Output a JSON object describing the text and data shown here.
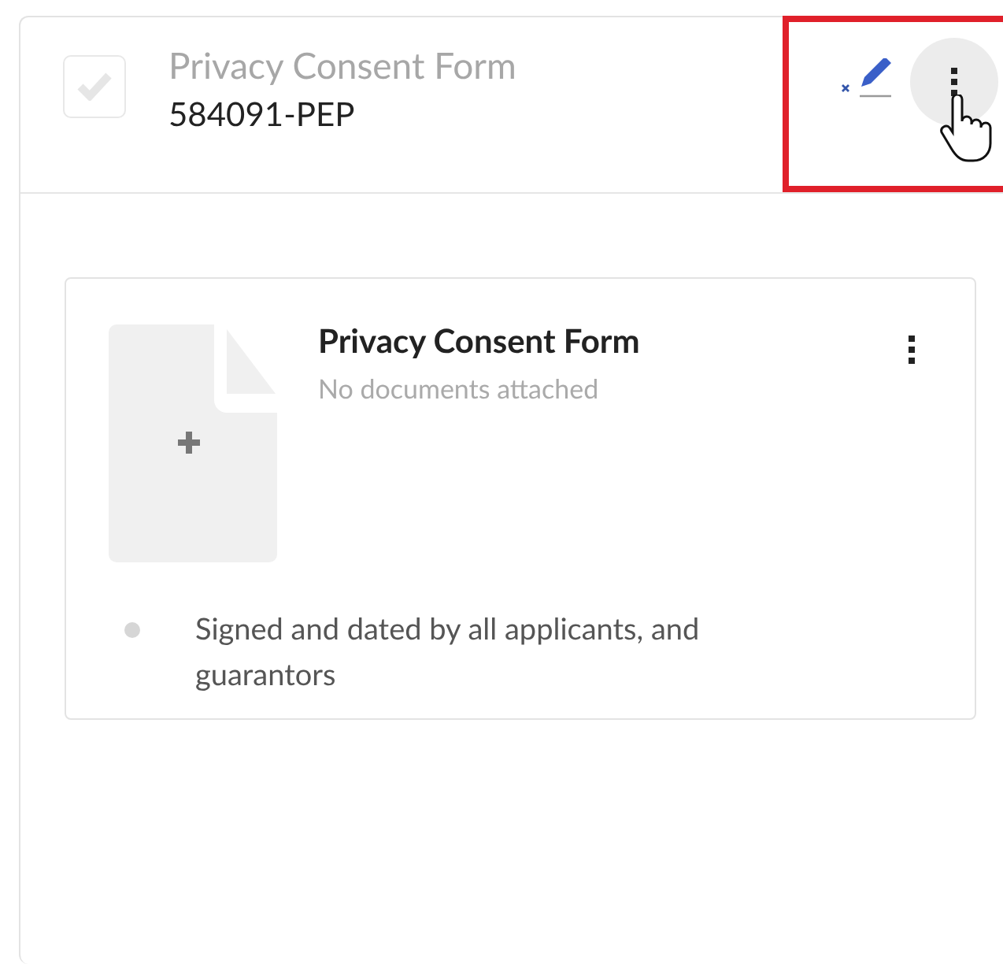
{
  "header": {
    "checkbox": {
      "checked": false
    },
    "title": "Privacy Consent Form",
    "code": "584091-PEP",
    "highlighted": true
  },
  "document_card": {
    "title": "Privacy Consent Form",
    "status": "No documents attached",
    "requirements": [
      "Signed and dated by all applicants, and guarantors"
    ]
  }
}
